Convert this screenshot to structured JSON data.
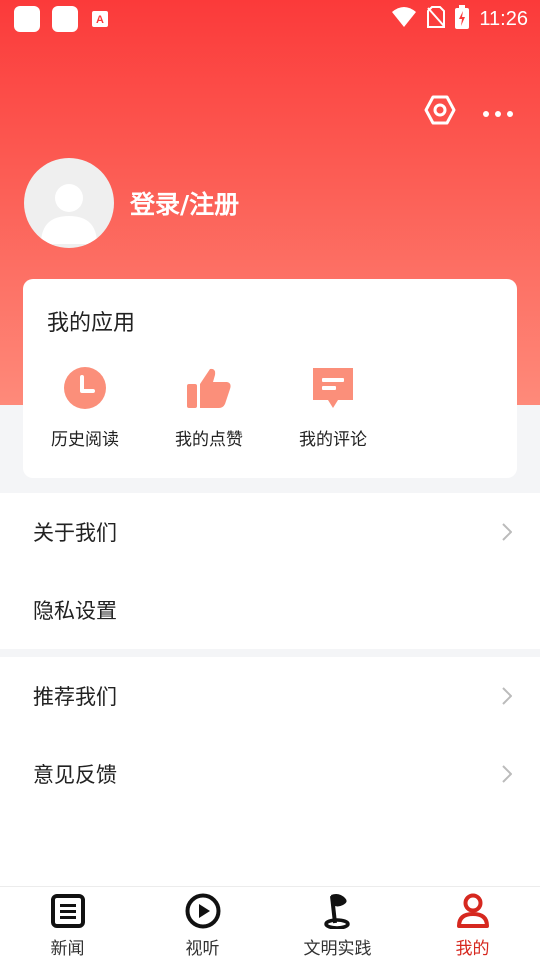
{
  "status_bar": {
    "time": "11:26",
    "icons": [
      "app-square-icon",
      "app-square-icon",
      "app-a-icon",
      "wifi-icon",
      "no-sim-icon",
      "battery-charging-icon"
    ]
  },
  "header": {
    "settings_icon": "hexagon-settings-icon",
    "more_icon": "more-dots-icon"
  },
  "profile": {
    "login_label": "登录/注册",
    "avatar_icon": "default-avatar-icon"
  },
  "apps": {
    "title": "我的应用",
    "items": [
      {
        "label": "历史阅读",
        "icon": "clock-icon"
      },
      {
        "label": "我的点赞",
        "icon": "thumbs-up-icon"
      },
      {
        "label": "我的评论",
        "icon": "comment-icon"
      }
    ]
  },
  "menu_group_1": {
    "items": [
      {
        "label": "关于我们",
        "chevron": true
      },
      {
        "label": "隐私设置",
        "chevron": false
      }
    ]
  },
  "menu_group_2": {
    "items": [
      {
        "label": "推荐我们",
        "chevron": true
      },
      {
        "label": "意见反馈",
        "chevron": true
      }
    ]
  },
  "bottom_nav": {
    "items": [
      {
        "label": "新闻",
        "icon": "news-icon"
      },
      {
        "label": "视听",
        "icon": "play-icon"
      },
      {
        "label": "文明实践",
        "icon": "flag-icon"
      },
      {
        "label": "我的",
        "icon": "person-icon",
        "active": true
      }
    ]
  },
  "colors": {
    "header_top": "#fb3a3a",
    "header_bottom": "#fe8a7a",
    "app_icon": "#fb8f7a",
    "active_tab": "#d6281f"
  }
}
